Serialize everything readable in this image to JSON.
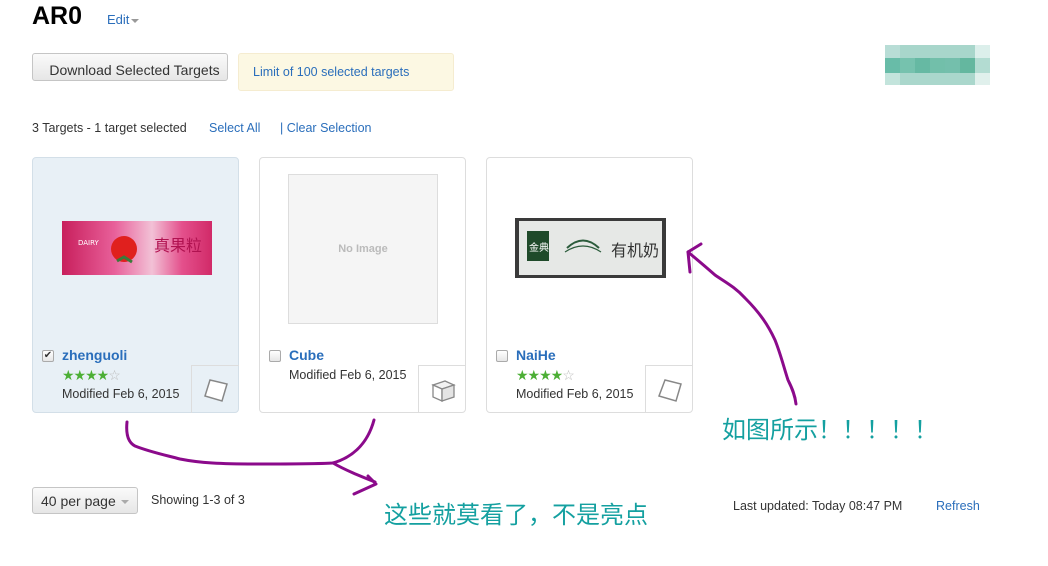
{
  "header": {
    "title": "AR0",
    "edit_label": "Edit"
  },
  "toolbar": {
    "download_label": "Download Selected Targets",
    "limit_notice": "Limit of 100 selected targets"
  },
  "selection": {
    "summary": "3 Targets - 1 target selected",
    "select_all": "Select All",
    "clear_selection": "| Clear Selection"
  },
  "targets": [
    {
      "name": "zhenguoli",
      "selected": true,
      "rating": 4,
      "rating_max": 5,
      "stars_on": "★★★★",
      "stars_off": "☆",
      "modified": "Modified Feb 6, 2015",
      "type_icon": "image-target-icon",
      "thumbnail": "strawberry-milk-carton"
    },
    {
      "name": "Cube",
      "selected": false,
      "no_image": "No Image",
      "modified": "Modified Feb 6, 2015",
      "type_icon": "cube-icon"
    },
    {
      "name": "NaiHe",
      "selected": false,
      "rating": 4,
      "rating_max": 5,
      "stars_on": "★★★★",
      "stars_off": "☆",
      "modified": "Modified Feb 6, 2015",
      "type_icon": "image-target-icon",
      "thumbnail": "milk-carton"
    }
  ],
  "footer": {
    "per_page": "40 per page",
    "showing": "Showing 1-3 of 3",
    "last_updated": "Last updated: Today 08:47 PM",
    "refresh": "Refresh"
  },
  "annotations": {
    "note1": "如图所示！！！！！",
    "note2": "这些就莫看了，不是亮点",
    "text_color": "#14a0a0",
    "stroke_color": "#8b0a8b"
  },
  "colors": {
    "link": "#2a6ebb",
    "star": "#4caf35",
    "selected_card": "#e8f0f6",
    "notice_bg": "#fcf8e3"
  }
}
